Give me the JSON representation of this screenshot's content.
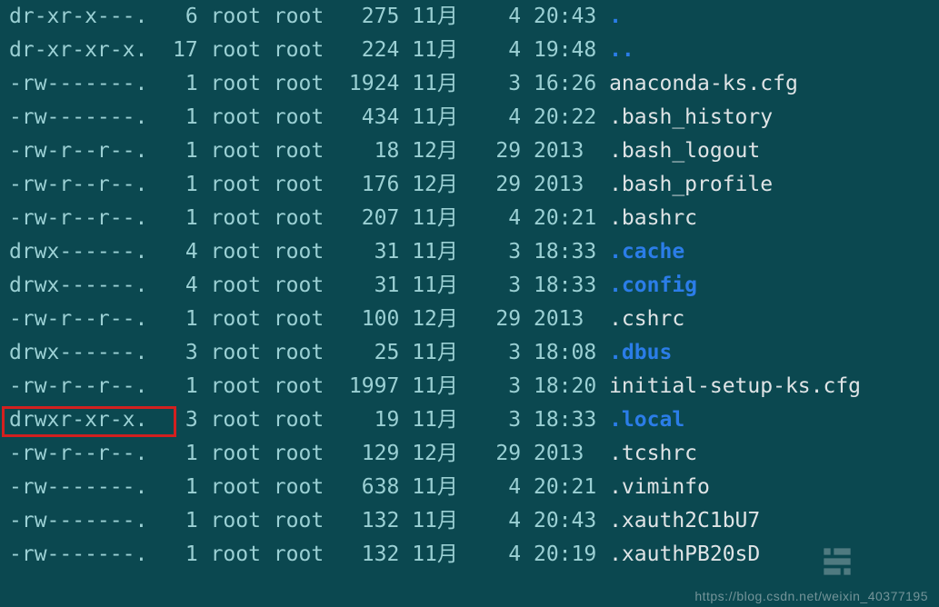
{
  "terminal": {
    "columns": {
      "perms_w": 12,
      "links_w": 3,
      "owner_w": 5,
      "group_w": 5,
      "size_w": 5,
      "month_w": 5,
      "day_w": 3,
      "time_w": 6
    },
    "rows": [
      {
        "perms": "dr-xr-x---.",
        "links": "6",
        "owner": "root",
        "group": "root",
        "size": "275",
        "month": "11月",
        "day": "4",
        "time": "20:43",
        "name": ".",
        "is_dir": true
      },
      {
        "perms": "dr-xr-xr-x.",
        "links": "17",
        "owner": "root",
        "group": "root",
        "size": "224",
        "month": "11月",
        "day": "4",
        "time": "19:48",
        "name": "..",
        "is_dir": true
      },
      {
        "perms": "-rw-------.",
        "links": "1",
        "owner": "root",
        "group": "root",
        "size": "1924",
        "month": "11月",
        "day": "3",
        "time": "16:26",
        "name": "anaconda-ks.cfg",
        "is_dir": false
      },
      {
        "perms": "-rw-------.",
        "links": "1",
        "owner": "root",
        "group": "root",
        "size": "434",
        "month": "11月",
        "day": "4",
        "time": "20:22",
        "name": ".bash_history",
        "is_dir": false
      },
      {
        "perms": "-rw-r--r--.",
        "links": "1",
        "owner": "root",
        "group": "root",
        "size": "18",
        "month": "12月",
        "day": "29",
        "time": "2013",
        "name": ".bash_logout",
        "is_dir": false
      },
      {
        "perms": "-rw-r--r--.",
        "links": "1",
        "owner": "root",
        "group": "root",
        "size": "176",
        "month": "12月",
        "day": "29",
        "time": "2013",
        "name": ".bash_profile",
        "is_dir": false
      },
      {
        "perms": "-rw-r--r--.",
        "links": "1",
        "owner": "root",
        "group": "root",
        "size": "207",
        "month": "11月",
        "day": "4",
        "time": "20:21",
        "name": ".bashrc",
        "is_dir": false
      },
      {
        "perms": "drwx------.",
        "links": "4",
        "owner": "root",
        "group": "root",
        "size": "31",
        "month": "11月",
        "day": "3",
        "time": "18:33",
        "name": ".cache",
        "is_dir": true
      },
      {
        "perms": "drwx------.",
        "links": "4",
        "owner": "root",
        "group": "root",
        "size": "31",
        "month": "11月",
        "day": "3",
        "time": "18:33",
        "name": ".config",
        "is_dir": true
      },
      {
        "perms": "-rw-r--r--.",
        "links": "1",
        "owner": "root",
        "group": "root",
        "size": "100",
        "month": "12月",
        "day": "29",
        "time": "2013",
        "name": ".cshrc",
        "is_dir": false
      },
      {
        "perms": "drwx------.",
        "links": "3",
        "owner": "root",
        "group": "root",
        "size": "25",
        "month": "11月",
        "day": "3",
        "time": "18:08",
        "name": ".dbus",
        "is_dir": true
      },
      {
        "perms": "-rw-r--r--.",
        "links": "1",
        "owner": "root",
        "group": "root",
        "size": "1997",
        "month": "11月",
        "day": "3",
        "time": "18:20",
        "name": "initial-setup-ks.cfg",
        "is_dir": false
      },
      {
        "perms": "drwxr-xr-x.",
        "links": "3",
        "owner": "root",
        "group": "root",
        "size": "19",
        "month": "11月",
        "day": "3",
        "time": "18:33",
        "name": ".local",
        "is_dir": true,
        "highlight": true
      },
      {
        "perms": "-rw-r--r--.",
        "links": "1",
        "owner": "root",
        "group": "root",
        "size": "129",
        "month": "12月",
        "day": "29",
        "time": "2013",
        "name": ".tcshrc",
        "is_dir": false
      },
      {
        "perms": "-rw-------.",
        "links": "1",
        "owner": "root",
        "group": "root",
        "size": "638",
        "month": "11月",
        "day": "4",
        "time": "20:21",
        "name": ".viminfo",
        "is_dir": false
      },
      {
        "perms": "-rw-------.",
        "links": "1",
        "owner": "root",
        "group": "root",
        "size": "132",
        "month": "11月",
        "day": "4",
        "time": "20:43",
        "name": ".xauth2C1bU7",
        "is_dir": false
      },
      {
        "perms": "-rw-------.",
        "links": "1",
        "owner": "root",
        "group": "root",
        "size": "132",
        "month": "11月",
        "day": "4",
        "time": "20:19",
        "name": ".xauthPB20sD",
        "is_dir": false
      }
    ]
  },
  "watermark": "https://blog.csdn.net/weixin_40377195"
}
